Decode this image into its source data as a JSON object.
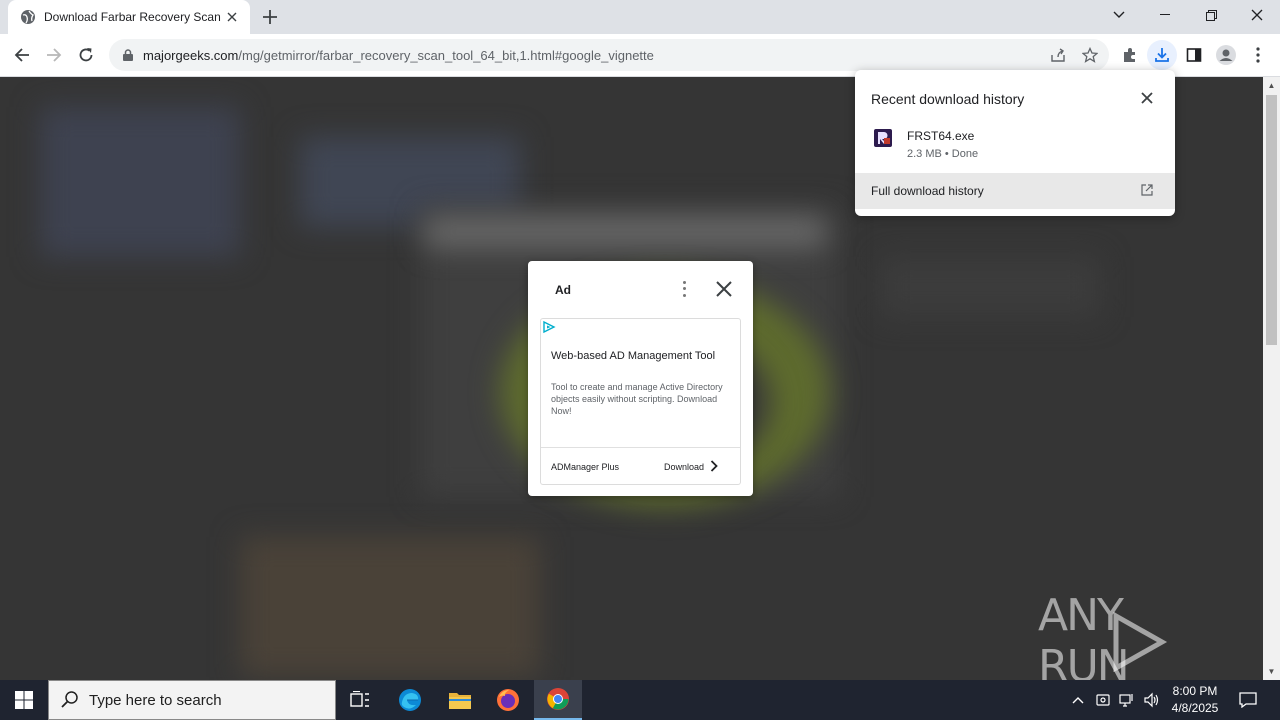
{
  "browser": {
    "tab_title": "Download Farbar Recovery Scan",
    "url_host": "majorgeeks.com",
    "url_path": "/mg/getmirror/farbar_recovery_scan_tool_64_bit,1.html#google_vignette"
  },
  "ad": {
    "label": "Ad",
    "headline": "Web-based AD Management Tool",
    "body": "Tool to create and manage Active Directory objects easily without scripting. Download Now!",
    "advertiser": "ADManager Plus",
    "cta": "Download"
  },
  "downloads": {
    "title": "Recent download history",
    "file_name": "FRST64.exe",
    "file_meta": "2.3 MB • Done",
    "full_history": "Full download history"
  },
  "watermark": "ANY RUN",
  "taskbar": {
    "search_placeholder": "Type here to search",
    "time": "8:00 PM",
    "date": "4/8/2025"
  },
  "colors": {
    "accent": "#1a73e8",
    "taskbar_bg": "#1f2430",
    "page_dim": "#353535"
  }
}
